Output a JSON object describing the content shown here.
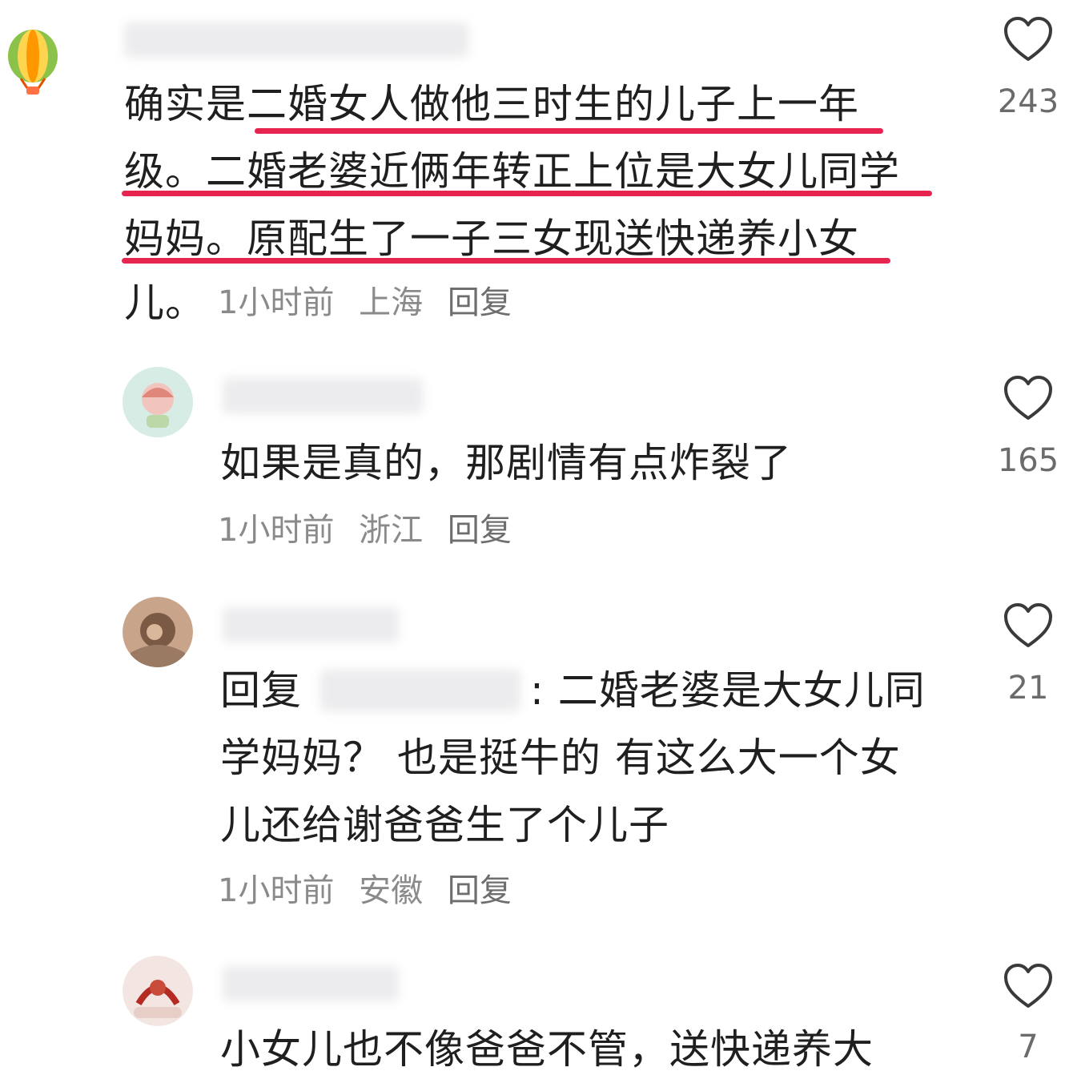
{
  "comments": [
    {
      "lines": [
        "确实是二婚女人做他三时生的儿子上一年",
        "级。二婚老婆近俩年转正上位是大女儿同学",
        "妈妈。原配生了一子三女现送快递养小女",
        "儿。"
      ],
      "time": "1小时前",
      "location": "上海",
      "reply": "回复",
      "likes": "243"
    },
    {
      "lines": [
        "如果是真的，那剧情有点炸裂了"
      ],
      "time": "1小时前",
      "location": "浙江",
      "reply": "回复",
      "likes": "165"
    },
    {
      "reply_prefix": "回复",
      "lines": [
        ": 二婚老婆是大女儿同",
        "学妈妈？ 也是挺牛的 有这么大一个女",
        "儿还给谢爸爸生了个儿子"
      ],
      "time": "1小时前",
      "location": "安徽",
      "reply": "回复",
      "likes": "21"
    },
    {
      "lines": [
        "小女儿也不像爸爸不管，送快递养大"
      ],
      "likes": "7"
    }
  ],
  "colors": {
    "highlight": "#e6244f",
    "meta": "#8a8a8a"
  },
  "icons": {
    "like": "heart-outline-icon",
    "avatar1": "hot-air-balloon-avatar"
  }
}
